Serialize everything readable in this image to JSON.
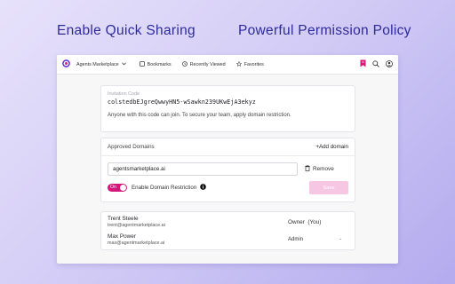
{
  "headlines": {
    "left": "Enable Quick Sharing",
    "right": "Powerful Permission Policy"
  },
  "topbar": {
    "workspace": "Agents Marketplace",
    "nav": [
      "Bookmarks",
      "Recently Viewed",
      "Favorites"
    ],
    "icons": [
      "bookmark-icon",
      "search-icon",
      "user-icon"
    ],
    "accent": "#d5157a"
  },
  "invitation": {
    "label": "Invitation Code",
    "code": "colstedbEJgreQwwyHN5-wSawkn239UKwEjA3ekyz",
    "description": "Anyone with this code can join. To secure your team, apply domain restriction."
  },
  "domains": {
    "title": "Approved Domains",
    "add_label": "+Add domain",
    "input_value": "agentsmarketplace.ai",
    "remove_label": "Remove",
    "toggle_label": "On",
    "toggle_on": true,
    "restriction_label": "Enable Domain Restriction",
    "save_label": "Save"
  },
  "members": [
    {
      "name": "Trent Steele",
      "email": "trent@agentmarketplace.ai",
      "role": "Owner  (You)"
    },
    {
      "name": "Max Power",
      "email": "max@agentmarketplace.ai",
      "role": "Admin",
      "role_caret": "-"
    }
  ]
}
